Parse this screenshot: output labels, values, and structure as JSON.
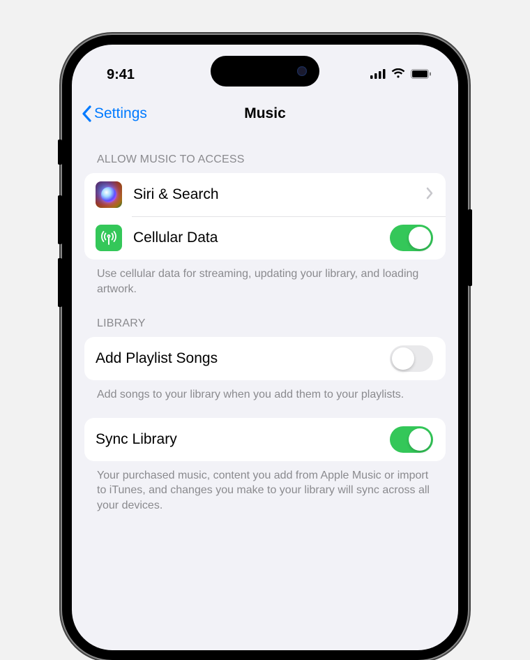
{
  "status": {
    "time": "9:41"
  },
  "nav": {
    "back": "Settings",
    "title": "Music"
  },
  "sections": {
    "access": {
      "header": "Allow Music to Access",
      "siri_label": "Siri & Search",
      "cellular_label": "Cellular Data",
      "cellular_on": true,
      "footer": "Use cellular data for streaming, updating your library, and loading artwork."
    },
    "library": {
      "header": "Library",
      "add_playlist_label": "Add Playlist Songs",
      "add_playlist_on": false,
      "add_playlist_footer": "Add songs to your library when you add them to your playlists.",
      "sync_label": "Sync Library",
      "sync_on": true,
      "sync_footer": "Your purchased music, content you add from Apple Music or import to iTunes, and changes you make to your library will sync across all your devices."
    }
  }
}
